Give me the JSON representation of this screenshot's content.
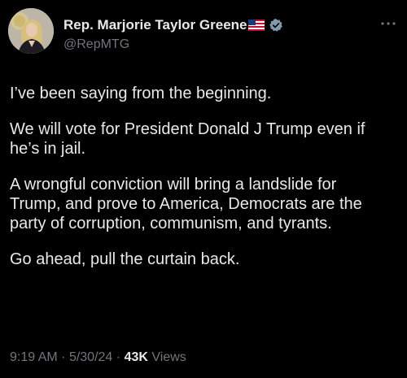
{
  "author": {
    "display_name": "Rep. Marjorie Taylor Greene",
    "flag_icon": "us-flag-icon",
    "verified_icon": "verified-badge-icon",
    "handle": "@RepMTG",
    "avatar_icon": "profile-avatar"
  },
  "tweet": {
    "paragraphs": [
      "I’ve been saying from the beginning.",
      "We will vote for President Donald J Trump even if\nhe’s in jail.",
      "A wrongful conviction will bring a landslide for\nTrump, and prove to America, Democrats are the\nparty of corruption, communism, and tyrants.",
      "Go ahead, pull the curtain back."
    ]
  },
  "meta": {
    "time": "9:19 AM",
    "separator": "·",
    "date": "5/30/24",
    "views_count": "43K",
    "views_label": "Views"
  },
  "colors": {
    "background": "#000000",
    "primary_text": "#e7e9ea",
    "secondary_text": "#71767b",
    "verified_badge": "#829aab"
  }
}
